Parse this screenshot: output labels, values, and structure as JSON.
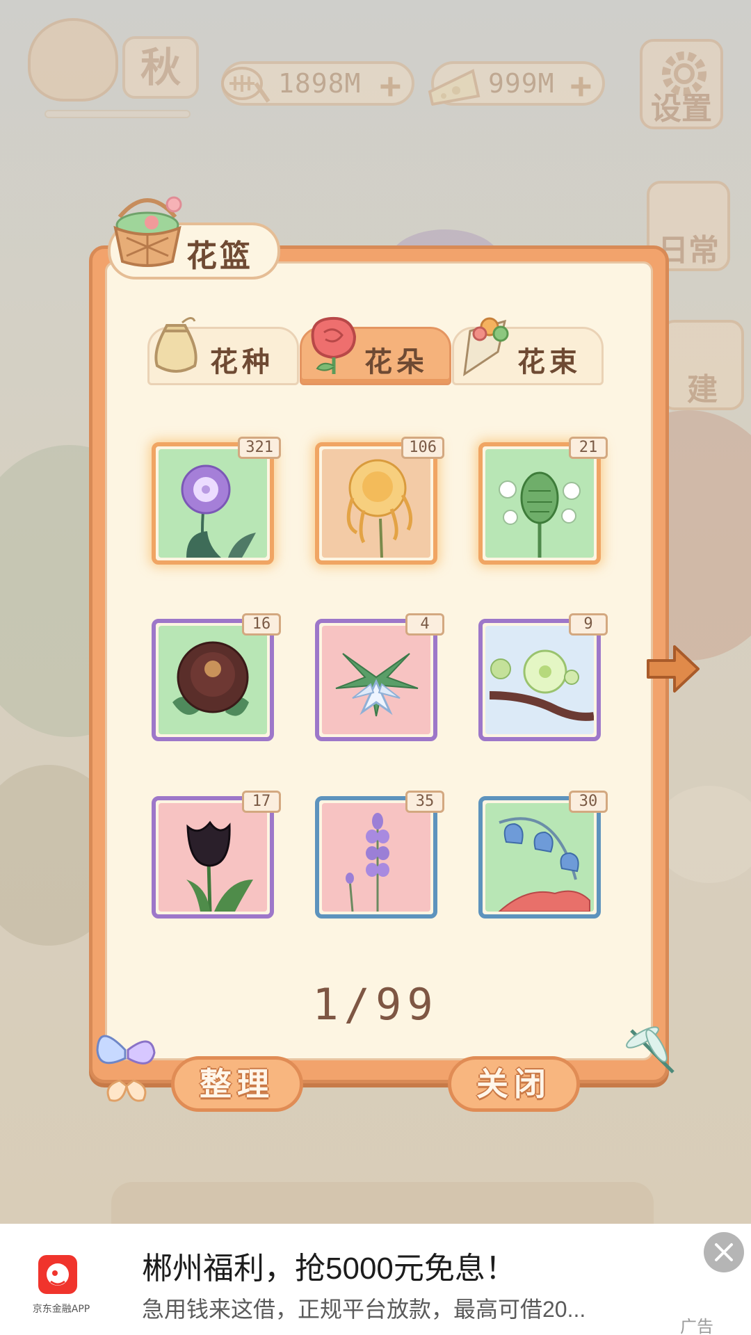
{
  "hud": {
    "season_label": "秋",
    "fish_amount": "1898M",
    "cheese_amount": "999M",
    "plus_symbol": "+",
    "settings_label": "设置",
    "daily_label": "日常",
    "build_label": "建"
  },
  "modal": {
    "title": "花篮",
    "tabs": [
      {
        "label": "花种",
        "icon": "seed-bag-icon",
        "active": false
      },
      {
        "label": "花朵",
        "icon": "rose-icon",
        "active": true
      },
      {
        "label": "花束",
        "icon": "bouquet-icon",
        "active": false
      }
    ],
    "items": [
      {
        "name": "purple-allium",
        "count": "321",
        "rarity": "gold",
        "bg": "#b8e6b5"
      },
      {
        "name": "golden-chrysanthemum",
        "count": "106",
        "rarity": "gold",
        "bg": "#f3cba6"
      },
      {
        "name": "green-protea",
        "count": "21",
        "rarity": "gold",
        "bg": "#b8e6b5"
      },
      {
        "name": "dark-peony",
        "count": "16",
        "rarity": "purple",
        "bg": "#b8e6b5"
      },
      {
        "name": "white-star-lily",
        "count": "4",
        "rarity": "purple",
        "bg": "#f7c3c2"
      },
      {
        "name": "green-plum-blossom",
        "count": "9",
        "rarity": "purple",
        "bg": "#dceaf7"
      },
      {
        "name": "black-tulip",
        "count": "17",
        "rarity": "purple",
        "bg": "#f7c3c2"
      },
      {
        "name": "lavender",
        "count": "35",
        "rarity": "blue",
        "bg": "#f7c3c2"
      },
      {
        "name": "bellflower",
        "count": "30",
        "rarity": "blue",
        "bg": "#b8e6b5"
      }
    ],
    "pager": "1/99",
    "sort_button": "整理",
    "close_button": "关闭"
  },
  "ad": {
    "brand": "京东金融APP",
    "title": "郴州福利，抢5000元免息！",
    "description": "急用钱来这借，正规平台放款，最高可借20...",
    "tag": "广告"
  },
  "colors": {
    "panel_orange": "#f2a36c",
    "panel_cream": "#fdf5e2",
    "frame_gold": "#f0a563",
    "frame_purple": "#9d77c9",
    "frame_blue": "#5d93bd"
  }
}
